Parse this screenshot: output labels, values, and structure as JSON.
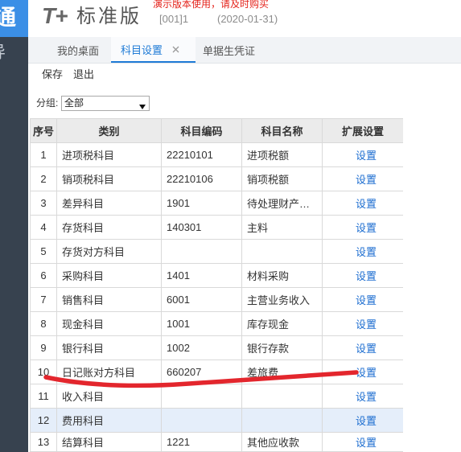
{
  "app": {
    "logo_mark": "T+",
    "edition": "标准版",
    "notice": "演示版本使用，请及时购买",
    "account": "[001]1",
    "date": "(2020-01-31)"
  },
  "sidebar": {
    "logo_glyph": "通",
    "nav_glyph": "导"
  },
  "tabs": [
    {
      "label": "我的桌面",
      "active": false
    },
    {
      "label": "科目设置",
      "active": true,
      "closable": true
    },
    {
      "label": "单据生凭证",
      "active": false
    }
  ],
  "toolbar": {
    "save_label": "保存",
    "exit_label": "退出"
  },
  "filter": {
    "label": "分组:",
    "selected": "全部"
  },
  "table": {
    "columns": [
      "序号",
      "类别",
      "科目编码",
      "科目名称",
      "扩展设置"
    ],
    "selected_row": 12,
    "rows": [
      {
        "index": "1",
        "category": "进项税科目",
        "code": "22210101",
        "name": "进项税额",
        "action": "设置"
      },
      {
        "index": "2",
        "category": "销项税科目",
        "code": "22210106",
        "name": "销项税额",
        "action": "设置"
      },
      {
        "index": "3",
        "category": "差异科目",
        "code": "1901",
        "name": "待处理财产…",
        "action": "设置"
      },
      {
        "index": "4",
        "category": "存货科目",
        "code": "140301",
        "name": "主料",
        "action": "设置"
      },
      {
        "index": "5",
        "category": "存货对方科目",
        "code": "",
        "name": "",
        "action": "设置"
      },
      {
        "index": "6",
        "category": "采购科目",
        "code": "1401",
        "name": "材料采购",
        "action": "设置"
      },
      {
        "index": "7",
        "category": "销售科目",
        "code": "6001",
        "name": "主营业务收入",
        "action": "设置"
      },
      {
        "index": "8",
        "category": "现金科目",
        "code": "1001",
        "name": "库存现金",
        "action": "设置"
      },
      {
        "index": "9",
        "category": "银行科目",
        "code": "1002",
        "name": "银行存款",
        "action": "设置"
      },
      {
        "index": "10",
        "category": "日记账对方科目",
        "code": "660207",
        "name": "差旅费",
        "action": "设置"
      },
      {
        "index": "11",
        "category": "收入科目",
        "code": "",
        "name": "",
        "action": "设置"
      },
      {
        "index": "12",
        "category": "费用科目",
        "code": "",
        "name": "",
        "action": "设置"
      },
      {
        "index": "13",
        "category": "结算科目",
        "code": "1221",
        "name": "其他应收款",
        "action": "设置"
      }
    ]
  },
  "icons": {
    "tab_close": "close-icon",
    "select_arrow": "dropdown-arrow-icon"
  },
  "colors": {
    "sidebar_bg": "#37424f",
    "brand": "#3b8fe6",
    "notice": "#e4231b",
    "active_tab": "#1f7bd6",
    "link": "#1c6dd0",
    "header_bg": "#ebebeb",
    "selected_bg": "#e5eefa",
    "annotation": "#e3262d"
  }
}
